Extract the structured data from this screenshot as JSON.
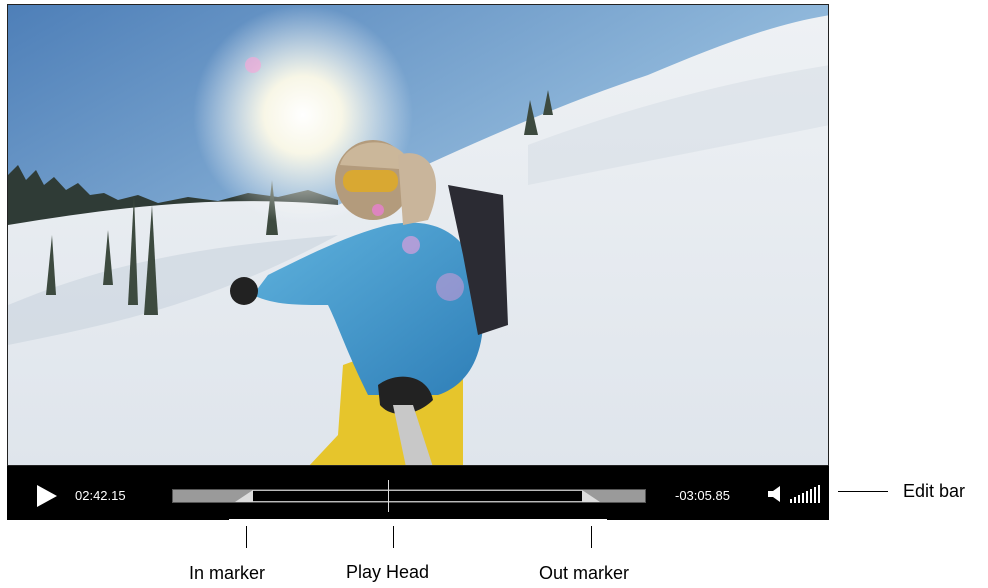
{
  "player": {
    "current_time": "02:42.15",
    "remaining_time": "-03:05.85",
    "in_marker_position": 0.13,
    "out_marker_position": 0.88,
    "playhead_position": 0.45
  },
  "callouts": {
    "edit_bar": "Edit bar",
    "in_marker": "In marker",
    "play_head": "Play Head",
    "out_marker": "Out marker"
  },
  "icons": {
    "play": "play-icon",
    "speaker": "speaker-icon",
    "volume": "volume-level-icon"
  },
  "colors": {
    "bar_background": "#000000",
    "track_inactive": "#9a9a9a",
    "marker": "#dddddd"
  }
}
